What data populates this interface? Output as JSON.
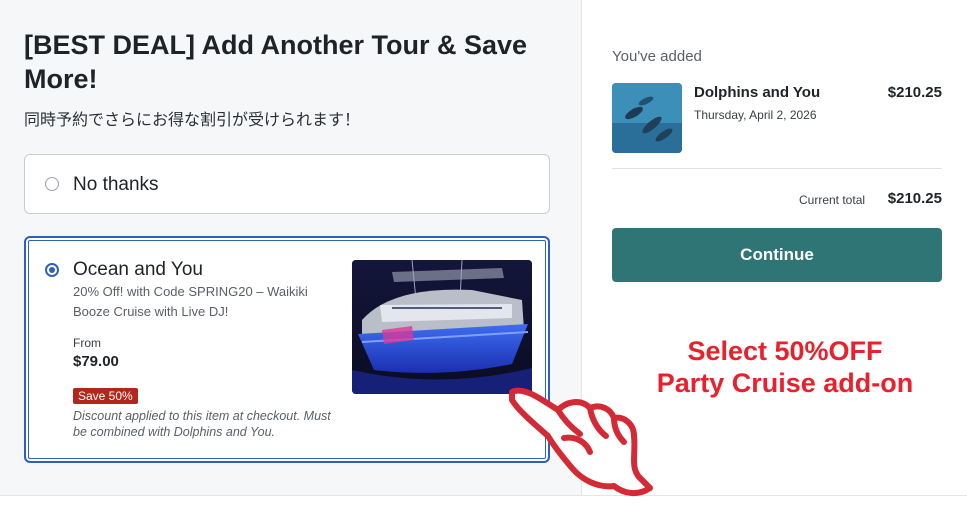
{
  "header": {
    "title": "[BEST DEAL] Add Another Tour & Save More!",
    "subtitle": "同時予約でさらにお得な割引が受けられます！"
  },
  "options": {
    "no_thanks": {
      "label": "No thanks",
      "selected": false
    },
    "ocean": {
      "name": "Ocean and You",
      "description": "20% Off! with Code SPRING20 – Waikiki Booze Cruise with Live DJ!",
      "from_label": "From",
      "price": "$79.00",
      "badge": "Save 50%",
      "note": "Discount applied to this item at checkout. Must be combined with Dolphins and You.",
      "selected": true,
      "image_icon": "boat-photo"
    }
  },
  "cart": {
    "added_label": "You've added",
    "item": {
      "name": "Dolphins and You",
      "date": "Thursday, April 2, 2026",
      "price": "$210.25",
      "image_icon": "dolphin-photo"
    },
    "total_label": "Current total",
    "total_price": "$210.25",
    "continue_label": "Continue"
  },
  "promo": {
    "line1": "Select 50%OFF",
    "line2": "Party Cruise add-on"
  },
  "colors": {
    "accent_blue": "#2f5fc1",
    "continue_teal": "#2f7575",
    "badge_red": "#b3261e",
    "promo_red": "#e8222c"
  }
}
